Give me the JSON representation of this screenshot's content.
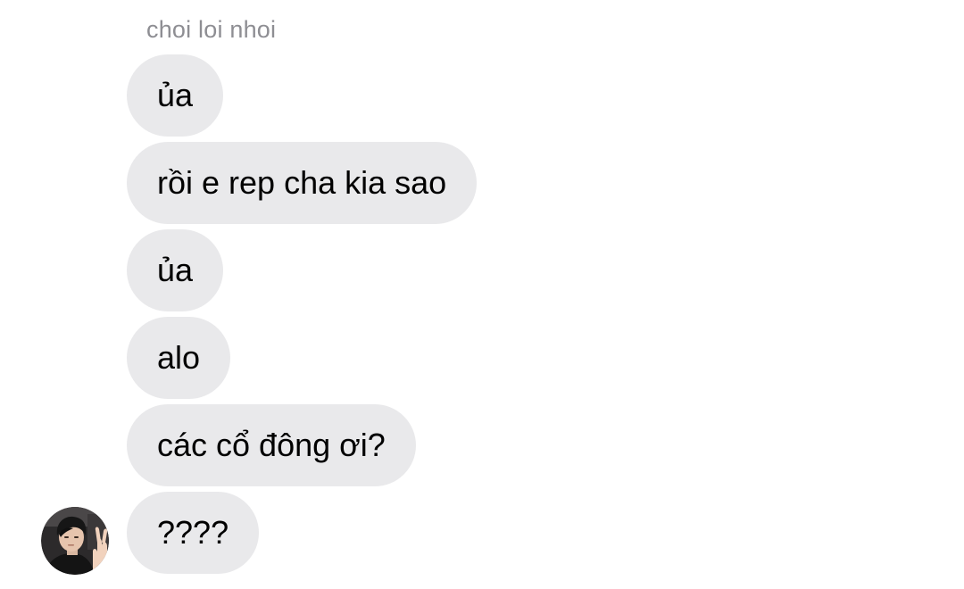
{
  "conversation": {
    "sender_name": "choi loi nhoi",
    "messages": [
      {
        "text": "ủa"
      },
      {
        "text": "rồi e rep cha kia sao"
      },
      {
        "text": "ủa"
      },
      {
        "text": "alo"
      },
      {
        "text": "các cổ đông ơi?"
      },
      {
        "text": "????"
      }
    ],
    "avatar": {
      "icon": "profile-photo"
    }
  },
  "colors": {
    "bubble_background": "#e9e9eb",
    "sender_name": "#8e8e93",
    "message_text": "#000000",
    "background": "#ffffff"
  }
}
